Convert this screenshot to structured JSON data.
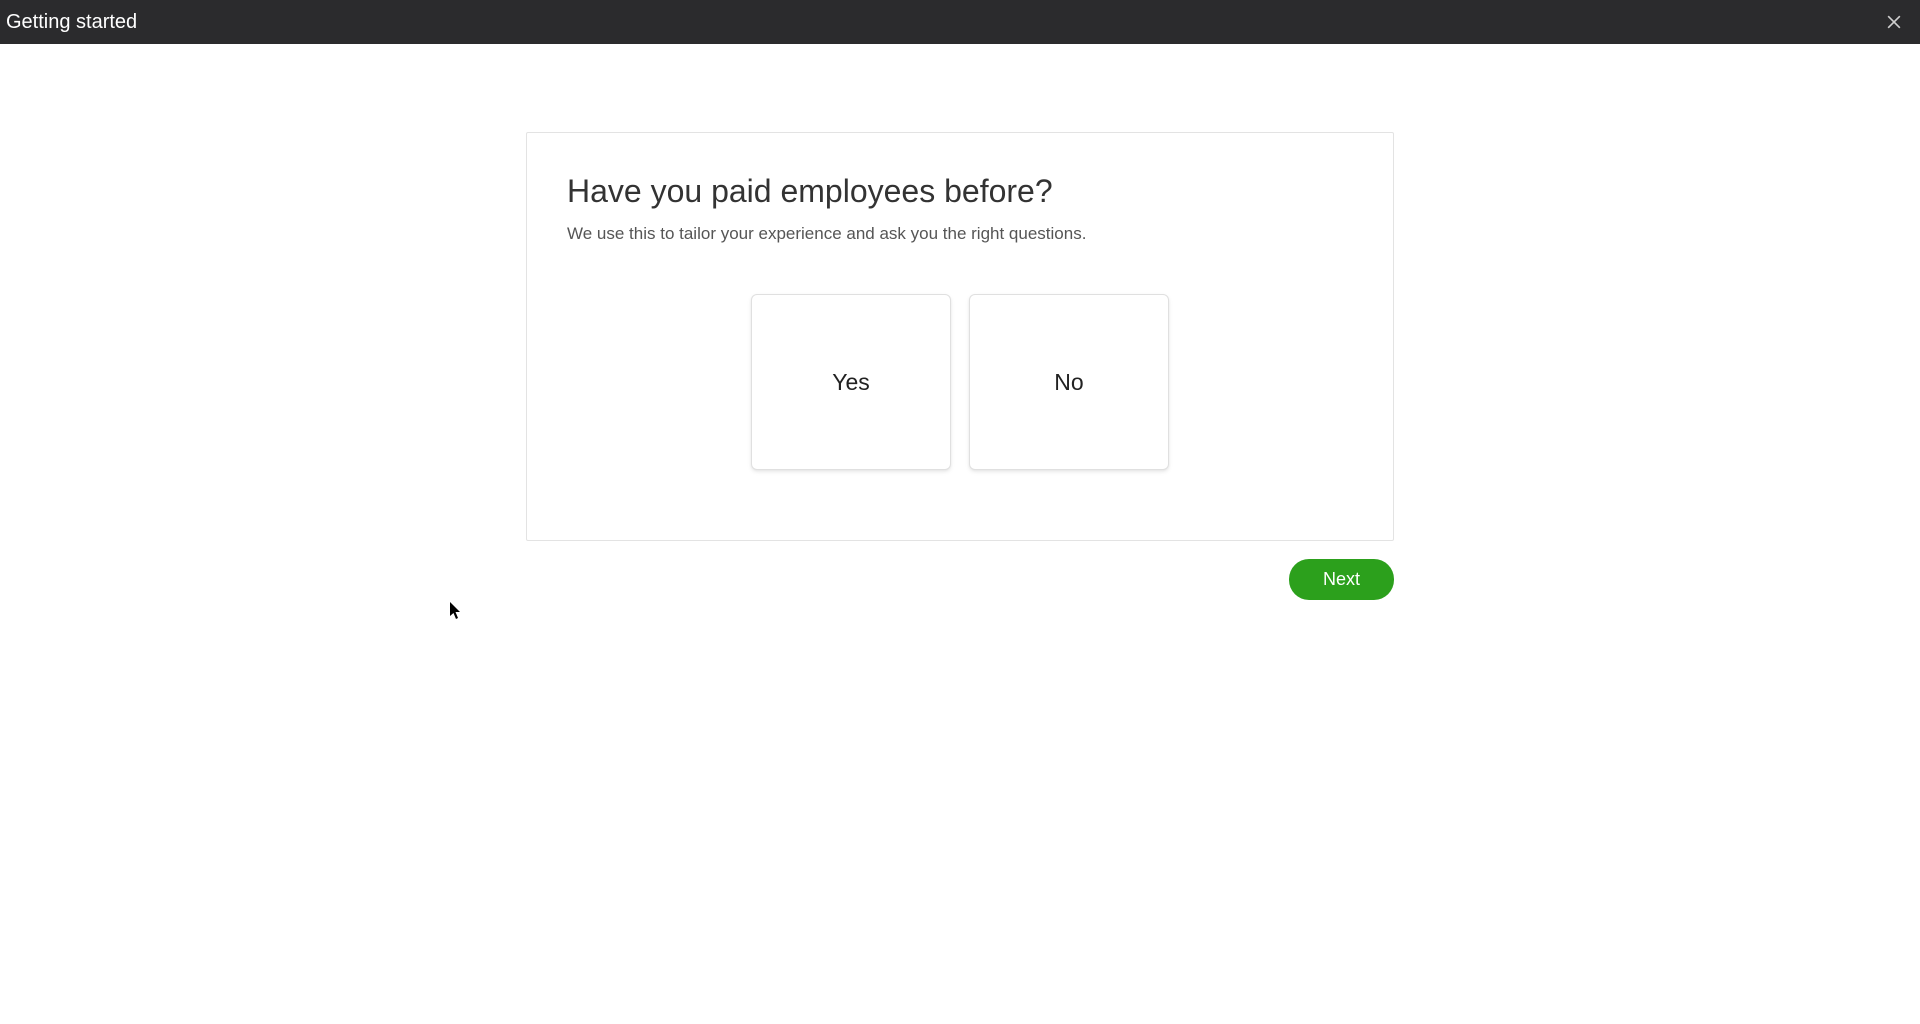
{
  "header": {
    "title": "Getting started"
  },
  "main": {
    "question": "Have you paid employees before?",
    "subtitle": "We use this to tailor your experience and ask you the right questions.",
    "options": {
      "yes": "Yes",
      "no": "No"
    }
  },
  "buttons": {
    "next": "Next"
  }
}
